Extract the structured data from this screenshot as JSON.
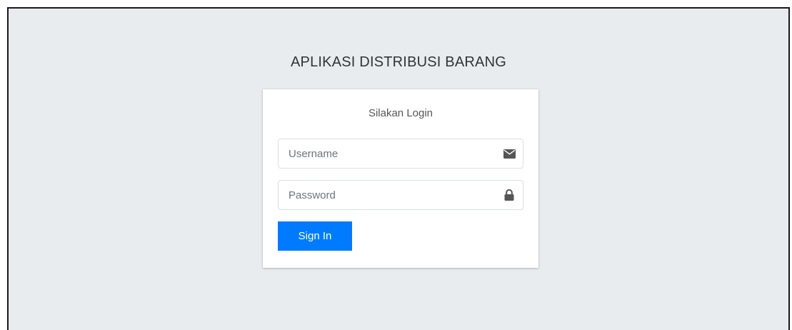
{
  "app": {
    "title": "APLIKASI DISTRIBUSI BARANG"
  },
  "login": {
    "message": "Silakan Login",
    "username": {
      "value": "",
      "placeholder": "Username",
      "icon": "envelope-icon"
    },
    "password": {
      "value": "",
      "placeholder": "Password",
      "icon": "lock-icon"
    },
    "submit_label": "Sign In"
  },
  "colors": {
    "background": "#e9ecef",
    "card": "#ffffff",
    "primary": "#007bff",
    "icon": "#555555"
  }
}
